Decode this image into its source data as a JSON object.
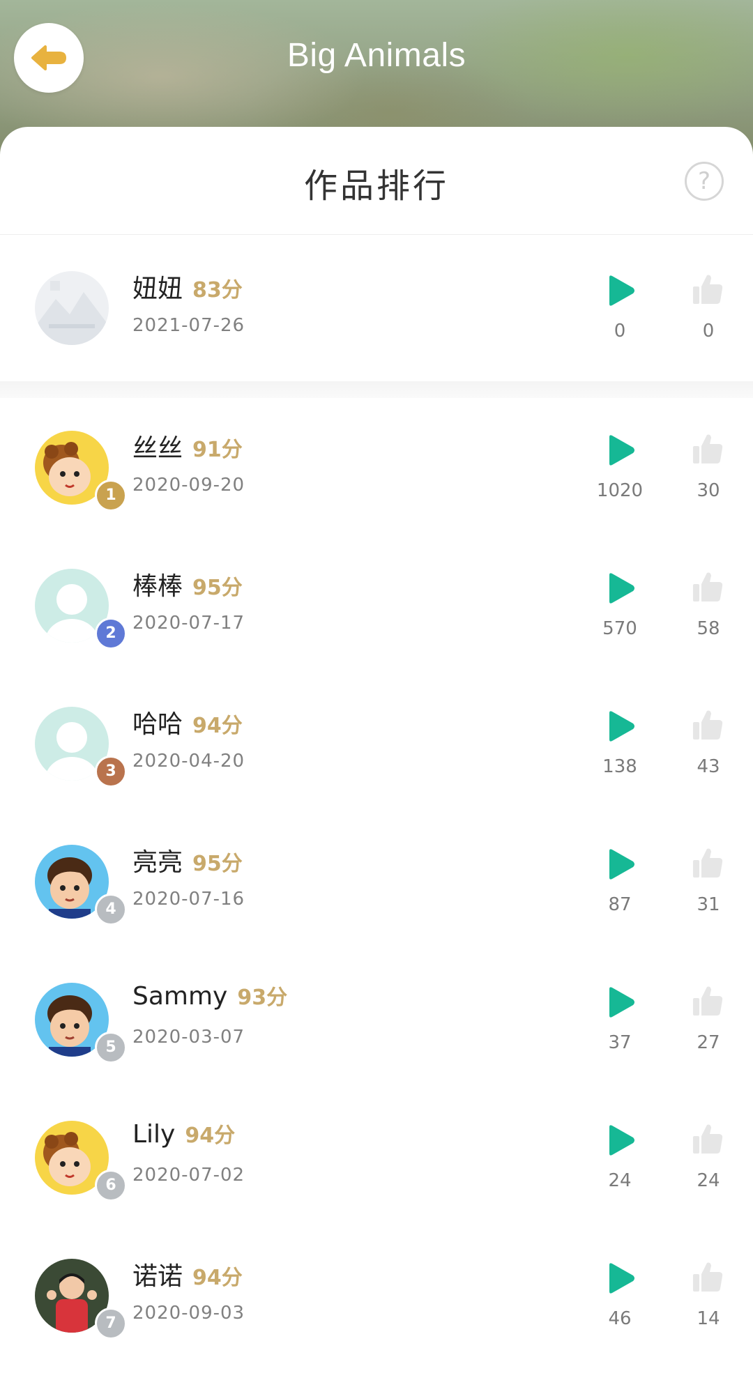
{
  "header": {
    "title": "Big Animals",
    "back_icon": "arrow-left-icon"
  },
  "section": {
    "title": "作品排行",
    "help_icon": "?"
  },
  "my_entry": {
    "name": "妞妞",
    "score": "83分",
    "date": "2021-07-26",
    "plays": "0",
    "likes": "0",
    "avatar": "placeholder-image-icon"
  },
  "ranking": [
    {
      "rank": "1",
      "name": "丝丝",
      "score": "91分",
      "date": "2020-09-20",
      "plays": "1020",
      "likes": "30",
      "avatar": "cartoon-girl"
    },
    {
      "rank": "2",
      "name": "棒棒",
      "score": "95分",
      "date": "2020-07-17",
      "plays": "570",
      "likes": "58",
      "avatar": "default-user"
    },
    {
      "rank": "3",
      "name": "哈哈",
      "score": "94分",
      "date": "2020-04-20",
      "plays": "138",
      "likes": "43",
      "avatar": "default-user"
    },
    {
      "rank": "4",
      "name": "亮亮",
      "score": "95分",
      "date": "2020-07-16",
      "plays": "87",
      "likes": "31",
      "avatar": "cartoon-boy"
    },
    {
      "rank": "5",
      "name": "Sammy",
      "score": "93分",
      "date": "2020-03-07",
      "plays": "37",
      "likes": "27",
      "avatar": "cartoon-boy"
    },
    {
      "rank": "6",
      "name": "Lily",
      "score": "94分",
      "date": "2020-07-02",
      "plays": "24",
      "likes": "24",
      "avatar": "cartoon-girl"
    },
    {
      "rank": "7",
      "name": "诺诺",
      "score": "94分",
      "date": "2020-09-03",
      "plays": "46",
      "likes": "14",
      "avatar": "photo-child"
    }
  ],
  "colors": {
    "accent_play": "#16b895",
    "score": "#c8a96b",
    "like_icon": "#e6e6e6",
    "back_arrow": "#e8b23f",
    "rank1": "#c9a24f",
    "rank2": "#5f79d6",
    "rank3": "#b9734d",
    "rank_other": "#b8bcc0"
  }
}
